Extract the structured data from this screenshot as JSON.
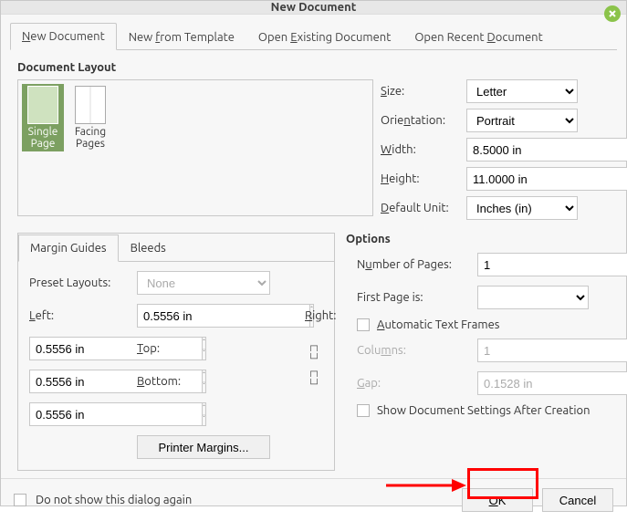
{
  "window": {
    "title": "New Document"
  },
  "tabs": {
    "new_document": "New Document",
    "new_from_template": "New from Template",
    "open_existing": "Open Existing Document",
    "open_recent": "Open Recent Document"
  },
  "layout": {
    "section_title": "Document Layout",
    "single_page": "Single Page",
    "facing_pages": "Facing Pages",
    "size_label": "Size:",
    "size_value": "Letter",
    "orientation_label": "Orientation:",
    "orientation_value": "Portrait",
    "width_label": "Width:",
    "width_value": "8.5000 in",
    "height_label": "Height:",
    "height_value": "11.0000 in",
    "unit_label": "Default Unit:",
    "unit_value": "Inches (in)"
  },
  "margins": {
    "tab_margin": "Margin Guides",
    "tab_bleeds": "Bleeds",
    "preset_label": "Preset Layouts:",
    "preset_value": "None",
    "left_label": "Left:",
    "left_value": "0.5556 in",
    "right_label": "Right:",
    "right_value": "0.5556 in",
    "top_label": "Top:",
    "top_value": "0.5556 in",
    "bottom_label": "Bottom:",
    "bottom_value": "0.5556 in",
    "printer_btn": "Printer Margins..."
  },
  "options": {
    "section_title": "Options",
    "num_pages_label": "Number of Pages:",
    "num_pages_value": "1",
    "first_page_label": "First Page is:",
    "first_page_value": "",
    "auto_frames": "Automatic Text Frames",
    "columns_label": "Columns:",
    "columns_value": "1",
    "gap_label": "Gap:",
    "gap_value": "0.1528 in",
    "show_after": "Show Document Settings After Creation"
  },
  "bottom": {
    "dont_show": "Do not show this dialog again",
    "ok": "OK",
    "cancel": "Cancel"
  }
}
